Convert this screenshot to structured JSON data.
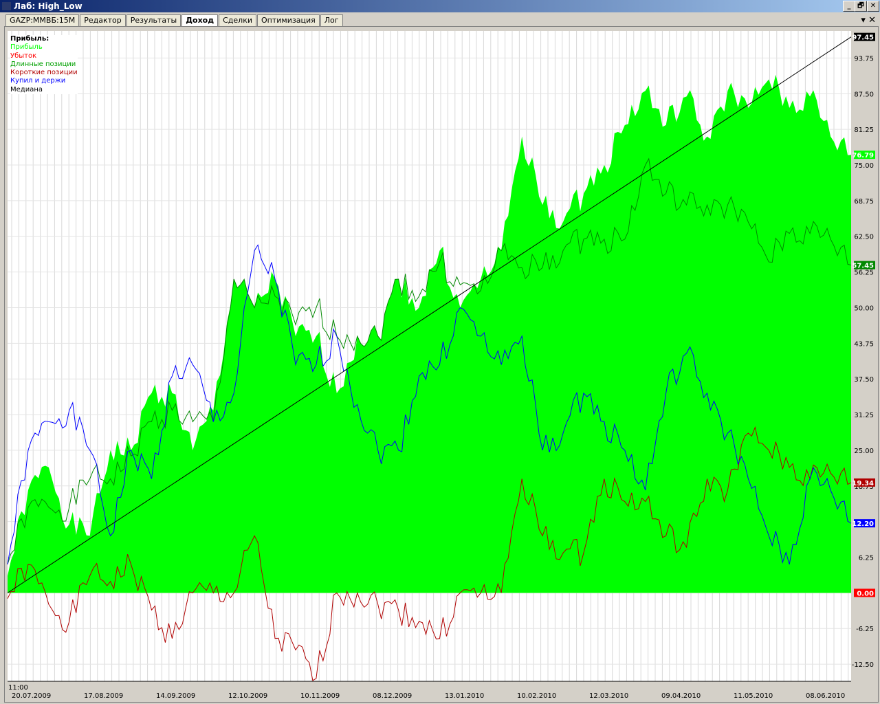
{
  "window": {
    "title": "Лаб: High_Low",
    "min": "_",
    "restore": "🗗",
    "close": "✕"
  },
  "tabs": [
    "GAZP:MMBБ:15M",
    "Редактор",
    "Результаты",
    "Доход",
    "Сделки",
    "Оптимизация",
    "Лог"
  ],
  "active_tab": 3,
  "panel": {
    "menu": "▾",
    "close": "✕"
  },
  "chart_data": {
    "type": "line",
    "legend_title": "Прибыль:",
    "legend": [
      {
        "name": "Прибыль",
        "color": "#00ff00"
      },
      {
        "name": "Убыток",
        "color": "#ff0000"
      },
      {
        "name": "Длинные позиции",
        "color": "#00a000"
      },
      {
        "name": "Короткие позиции",
        "color": "#b00000"
      },
      {
        "name": "Купил и держи",
        "color": "#0000ff"
      },
      {
        "name": "Медиана",
        "color": "#000000"
      }
    ],
    "legend_placement": "top-left",
    "ylim": [
      -15.5,
      98.5
    ],
    "yticks": [
      "93.75",
      "87.50",
      "81.25",
      "75.00",
      "68.75",
      "62.50",
      "56.25",
      "50.00",
      "43.75",
      "37.50",
      "31.25",
      "25.00",
      "18.75",
      "12.50",
      "6.25",
      "0.00",
      "-6.25",
      "-12.50"
    ],
    "time_label": "11:00",
    "xticks": [
      "20.07.2009",
      "17.08.2009",
      "14.09.2009",
      "12.10.2009",
      "10.11.2009",
      "08.12.2009",
      "13.01.2010",
      "10.02.2010",
      "12.03.2010",
      "09.04.2010",
      "11.05.2010",
      "08.06.2010"
    ],
    "n_points": 42,
    "series": [
      {
        "name": "Прибыль",
        "color": "#00ff00",
        "kind": "area",
        "values": [
          3,
          18,
          22,
          12,
          10,
          25,
          25,
          35,
          35,
          25,
          32,
          55,
          50,
          55,
          45,
          45,
          35,
          45,
          45,
          55,
          50,
          60,
          50,
          55,
          60,
          80,
          68,
          65,
          70,
          75,
          82,
          88,
          82,
          87,
          80,
          88,
          85,
          90,
          85,
          87,
          80,
          76.79
        ]
      },
      {
        "name": "Длинные позиции",
        "color": "#008800",
        "values": [
          5,
          15,
          15,
          15,
          20,
          20,
          24,
          30,
          32,
          30,
          30,
          55,
          50,
          52,
          47,
          50,
          45,
          45,
          45,
          55,
          52,
          58,
          54,
          53,
          60,
          57,
          57,
          60,
          62,
          62,
          62,
          75,
          70,
          68,
          68,
          68,
          65,
          58,
          63,
          63,
          62,
          57.45
        ]
      },
      {
        "name": "Короткие позиции",
        "color": "#b00000",
        "values": [
          -1,
          5,
          -2,
          -5,
          3,
          2,
          5,
          -3,
          -8,
          0,
          0,
          0,
          10,
          -8,
          -10,
          -15,
          0,
          0,
          -2,
          -3,
          -5,
          -8,
          0,
          0,
          0,
          20,
          10,
          7,
          7,
          20,
          16,
          16,
          10,
          8,
          20,
          18,
          28,
          25,
          22,
          20,
          21,
          19.34
        ]
      },
      {
        "name": "Купил и держи",
        "color": "#0000ff",
        "values": [
          5,
          25,
          30,
          32,
          25,
          10,
          25,
          20,
          38,
          40,
          30,
          35,
          60,
          55,
          40,
          40,
          45,
          33,
          25,
          25,
          38,
          40,
          50,
          45,
          40,
          45,
          25,
          28,
          35,
          30,
          25,
          18,
          35,
          42,
          35,
          28,
          20,
          10,
          5,
          20,
          18,
          12.2
        ]
      },
      {
        "name": "Медиана",
        "color": "#000000",
        "values": [
          0,
          97.45
        ]
      }
    ],
    "value_badges": [
      {
        "text": "97.45",
        "value": 97.45,
        "bg": "#000000",
        "fg": "#ffffff"
      },
      {
        "text": "76.79",
        "value": 76.79,
        "bg": "#00ff00",
        "fg": "#ffffff"
      },
      {
        "text": "57.45",
        "value": 57.45,
        "bg": "#008800",
        "fg": "#ffffff"
      },
      {
        "text": "19.34",
        "value": 19.34,
        "bg": "#b00000",
        "fg": "#ffffff"
      },
      {
        "text": "12.20",
        "value": 12.2,
        "bg": "#0000ff",
        "fg": "#ffffff"
      },
      {
        "text": "0.00",
        "value": 0,
        "bg": "#ff0000",
        "fg": "#ffffff"
      }
    ]
  }
}
